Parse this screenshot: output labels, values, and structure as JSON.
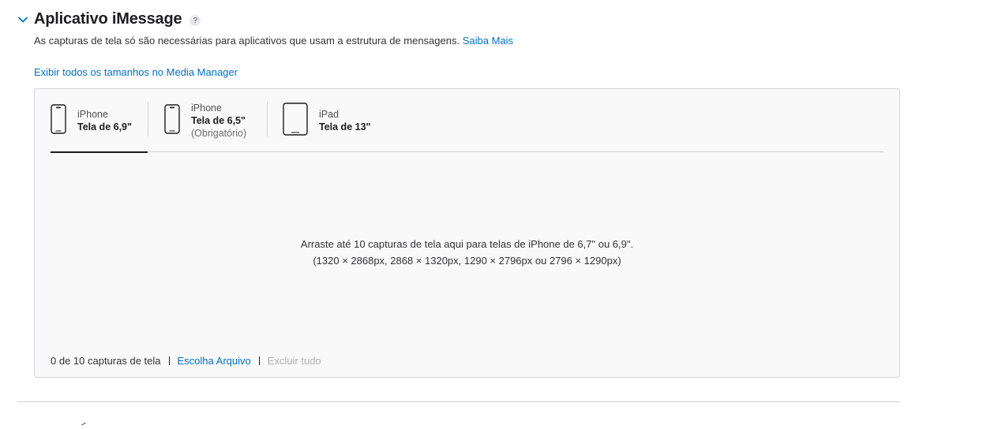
{
  "section": {
    "title": "Aplicativo iMessage",
    "help_glyph": "?",
    "description": "As capturas de tela só são necessárias para aplicativos que usam a estrutura de mensagens.",
    "learn_more": "Saiba Mais",
    "media_manager_link": "Exibir todos os tamanhos no Media Manager"
  },
  "tabs": [
    {
      "line1": "iPhone",
      "line2": "Tela de 6,9\"",
      "line3": "",
      "icon": "iphone-icon",
      "active": true
    },
    {
      "line1": "iPhone",
      "line2": "Tela de 6,5\"",
      "line3": "(Obrigatório)",
      "icon": "iphone-icon",
      "active": false
    },
    {
      "line1": "iPad",
      "line2": "Tela de 13\"",
      "line3": "",
      "icon": "ipad-icon",
      "active": false
    }
  ],
  "drop_zone": {
    "line1": "Arraste até 10 capturas de tela aqui para telas de iPhone de 6,7\" ou 6,9\".",
    "line2": "(1320 × 2868px, 2868 × 1320px, 1290 × 2796px ou 2796 × 1290px)"
  },
  "footer": {
    "count": "0 de 10 capturas de tela",
    "choose_file": "Escolha Arquivo",
    "delete_all": "Excluir tudo"
  },
  "colors": {
    "link": "#0070c9",
    "panel_bg": "#f9f9f9",
    "border": "#d2d2d7",
    "disabled": "#b0b0b5"
  }
}
